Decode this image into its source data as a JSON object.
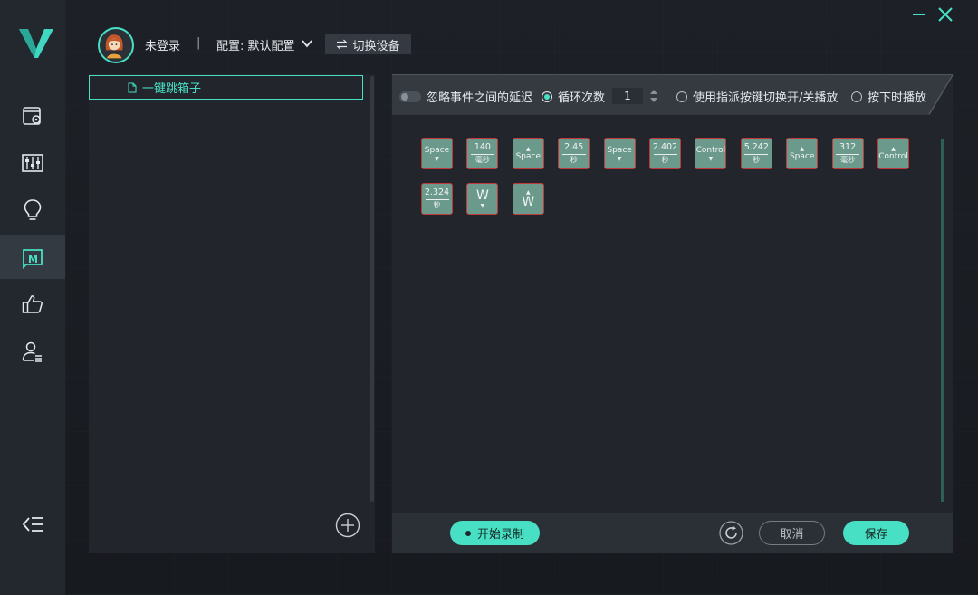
{
  "header": {
    "user_label": "未登录",
    "separator": "|",
    "config_label": "配置: 默认配置",
    "switch_device_label": "切换设备"
  },
  "macros": [
    {
      "name": "一键跳箱子"
    }
  ],
  "options": {
    "ignore_delay_label": "忽略事件之间的延迟",
    "loop_count_label": "循环次数",
    "loop_count_value": "1",
    "toggle_play_label": "使用指派按键切换开/关播放",
    "hold_play_label": "按下时播放"
  },
  "events": [
    {
      "type": "key",
      "label": "Space",
      "arrow": "▼"
    },
    {
      "type": "delay",
      "value": "140",
      "unit": "毫秒"
    },
    {
      "type": "key",
      "label": "Space",
      "arrow": "▲"
    },
    {
      "type": "delay",
      "value": "2.45",
      "unit": "秒"
    },
    {
      "type": "key",
      "label": "Space",
      "arrow": "▼"
    },
    {
      "type": "delay",
      "value": "2.402",
      "unit": "秒"
    },
    {
      "type": "key",
      "label": "Control",
      "arrow": "▼"
    },
    {
      "type": "delay",
      "value": "5.242",
      "unit": "秒"
    },
    {
      "type": "key",
      "label": "Space",
      "arrow": "▲"
    },
    {
      "type": "delay",
      "value": "312",
      "unit": "毫秒"
    },
    {
      "type": "key",
      "label": "Control",
      "arrow": "▲"
    },
    {
      "type": "delay",
      "value": "2.324",
      "unit": "秒"
    },
    {
      "type": "key",
      "label": "W",
      "arrow": "▼"
    },
    {
      "type": "key",
      "label": "W",
      "arrow": "▲"
    }
  ],
  "bottom": {
    "record_label": "开始录制",
    "cancel_label": "取消",
    "save_label": "保存"
  },
  "colors": {
    "accent": "#47e0c4",
    "key_fill": "#6b9a8d",
    "key_border": "#c13a3a"
  },
  "icons": {
    "logo": "v-logo-icon",
    "nav": [
      "settings-card-icon",
      "equalizer-icon",
      "lightbulb-icon",
      "macro-icon",
      "thumbs-up-icon",
      "user-list-icon"
    ],
    "collapse": "collapse-menu-icon"
  }
}
